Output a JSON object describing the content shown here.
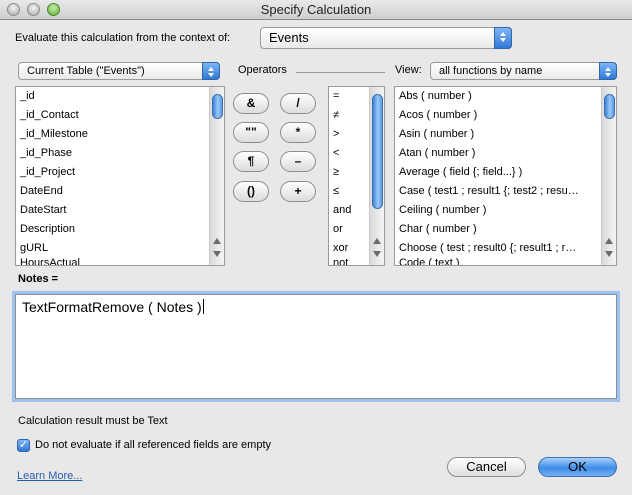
{
  "window": {
    "title": "Specify Calculation"
  },
  "context": {
    "label": "Evaluate this calculation from the context of:",
    "value": "Events"
  },
  "table": {
    "value": "Current Table (\"Events\")"
  },
  "operators_label": "Operators",
  "view": {
    "label": "View:",
    "value": "all functions by name"
  },
  "fields": [
    "_id",
    "_id_Contact",
    "_id_Milestone",
    "_id_Phase",
    "_id_Project",
    "DateEnd",
    "DateStart",
    "Description",
    "gURL",
    "HoursActual"
  ],
  "operator_buttons": [
    "&",
    "/",
    "\"\"",
    "*",
    "¶",
    "–",
    "()",
    "+"
  ],
  "comparison_ops": [
    "=",
    "≠",
    ">",
    "<",
    "≥",
    "≤",
    "and",
    "or",
    "xor",
    "not"
  ],
  "functions": [
    "Abs ( number )",
    "Acos ( number )",
    "Asin ( number )",
    "Atan ( number )",
    "Average ( field {; field...} )",
    "Case ( test1 ; result1 {; test2 ; resu…",
    "Ceiling ( number )",
    "Char ( number )",
    "Choose ( test ; result0 {; result1 ; r…",
    "Code ( text )"
  ],
  "formula": {
    "label": "Notes =",
    "value": "TextFormatRemove ( Notes )"
  },
  "result": {
    "label": "Calculation result must be Text"
  },
  "do_not_evaluate": {
    "label": "Do not evaluate if all referenced fields are empty",
    "checked": true
  },
  "learn_more": "Learn More...",
  "buttons": {
    "cancel": "Cancel",
    "ok": "OK"
  }
}
